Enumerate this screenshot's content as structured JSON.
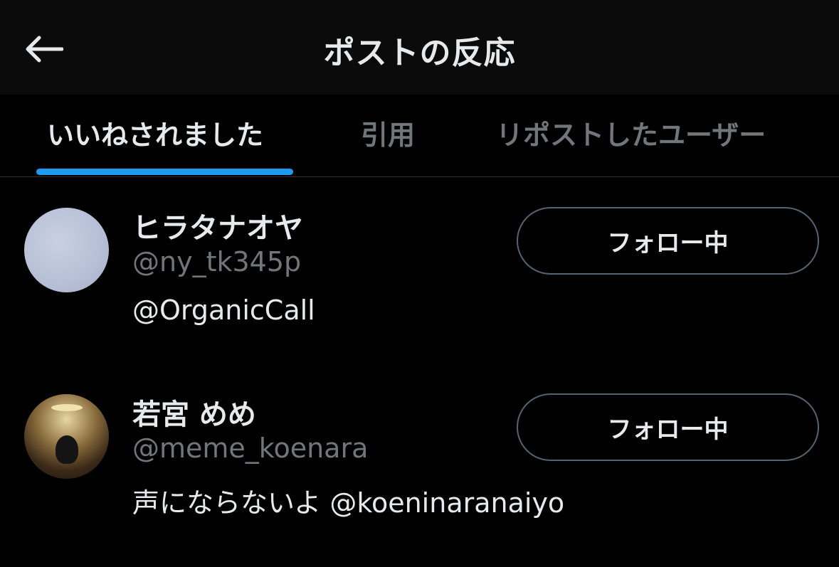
{
  "header": {
    "back_icon": "arrow-left-icon",
    "title": "ポストの反応"
  },
  "tabs": [
    {
      "label": "いいねされました",
      "active": true
    },
    {
      "label": "引用",
      "active": false
    },
    {
      "label": "リポストしたユーザー",
      "active": false
    }
  ],
  "accent_color": "#1d9bf0",
  "users": [
    {
      "display_name": "ヒラタナオヤ",
      "handle": "@ny_tk345p",
      "bio": "@OrganicCall",
      "follow_label": "フォロー中"
    },
    {
      "display_name": "若宮 めめ",
      "handle": "@meme_koenara",
      "bio": "声にならないよ @koeninaranaiyo",
      "follow_label": "フォロー中"
    }
  ]
}
